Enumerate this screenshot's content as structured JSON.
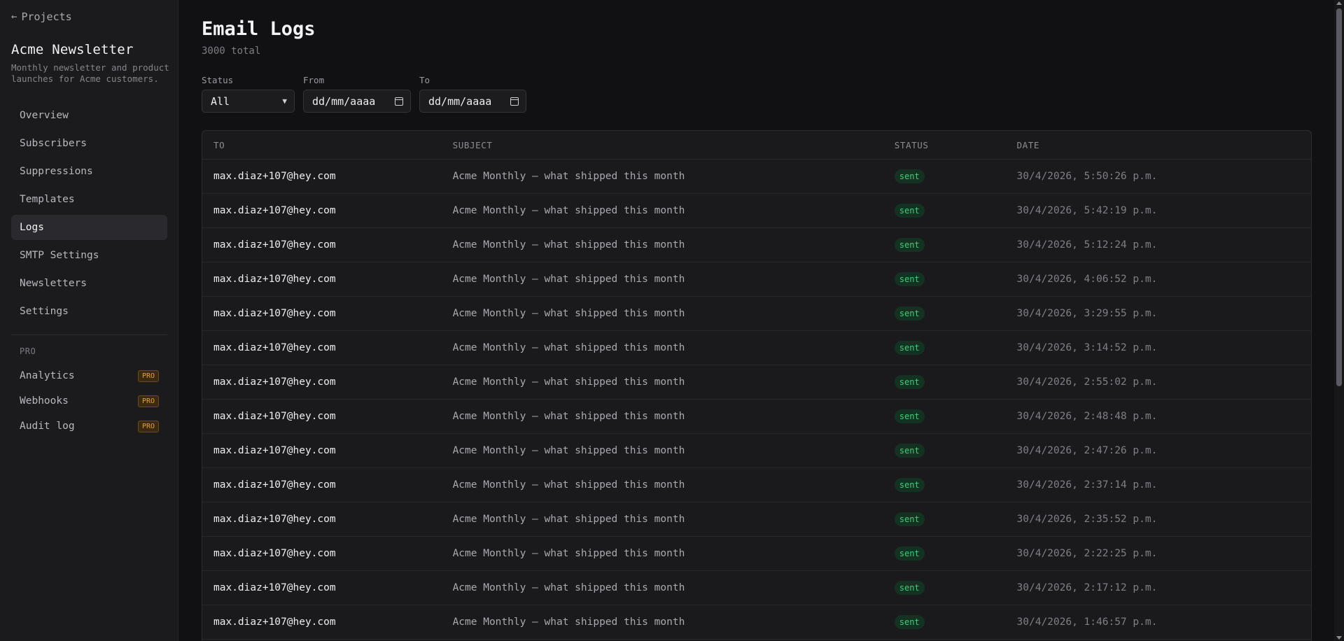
{
  "sidebar": {
    "back_label": "Projects",
    "project_name": "Acme Newsletter",
    "project_description": "Monthly newsletter and product launches for Acme customers.",
    "items": [
      {
        "label": "Overview"
      },
      {
        "label": "Subscribers"
      },
      {
        "label": "Suppressions"
      },
      {
        "label": "Templates"
      },
      {
        "label": "Logs",
        "active": true
      },
      {
        "label": "SMTP Settings"
      },
      {
        "label": "Newsletters"
      },
      {
        "label": "Settings"
      }
    ],
    "pro_heading": "PRO",
    "pro_items": [
      {
        "label": "Analytics",
        "badge": "PRO"
      },
      {
        "label": "Webhooks",
        "badge": "PRO"
      },
      {
        "label": "Audit log",
        "badge": "PRO"
      }
    ]
  },
  "header": {
    "title": "Email Logs",
    "subtitle": "3000 total"
  },
  "filters": {
    "status_label": "Status",
    "status_value": "All",
    "from_label": "From",
    "from_placeholder": "dd/mm/aaaa",
    "to_label": "To",
    "to_placeholder": "dd/mm/aaaa"
  },
  "table": {
    "columns": [
      "TO",
      "SUBJECT",
      "STATUS",
      "DATE"
    ],
    "rows": [
      {
        "to": "max.diaz+107@hey.com",
        "subject": "Acme Monthly — what shipped this month",
        "status": "sent",
        "date": "30/4/2026, 5:50:26 p.m."
      },
      {
        "to": "max.diaz+107@hey.com",
        "subject": "Acme Monthly — what shipped this month",
        "status": "sent",
        "date": "30/4/2026, 5:42:19 p.m."
      },
      {
        "to": "max.diaz+107@hey.com",
        "subject": "Acme Monthly — what shipped this month",
        "status": "sent",
        "date": "30/4/2026, 5:12:24 p.m."
      },
      {
        "to": "max.diaz+107@hey.com",
        "subject": "Acme Monthly — what shipped this month",
        "status": "sent",
        "date": "30/4/2026, 4:06:52 p.m."
      },
      {
        "to": "max.diaz+107@hey.com",
        "subject": "Acme Monthly — what shipped this month",
        "status": "sent",
        "date": "30/4/2026, 3:29:55 p.m."
      },
      {
        "to": "max.diaz+107@hey.com",
        "subject": "Acme Monthly — what shipped this month",
        "status": "sent",
        "date": "30/4/2026, 3:14:52 p.m."
      },
      {
        "to": "max.diaz+107@hey.com",
        "subject": "Acme Monthly — what shipped this month",
        "status": "sent",
        "date": "30/4/2026, 2:55:02 p.m."
      },
      {
        "to": "max.diaz+107@hey.com",
        "subject": "Acme Monthly — what shipped this month",
        "status": "sent",
        "date": "30/4/2026, 2:48:48 p.m."
      },
      {
        "to": "max.diaz+107@hey.com",
        "subject": "Acme Monthly — what shipped this month",
        "status": "sent",
        "date": "30/4/2026, 2:47:26 p.m."
      },
      {
        "to": "max.diaz+107@hey.com",
        "subject": "Acme Monthly — what shipped this month",
        "status": "sent",
        "date": "30/4/2026, 2:37:14 p.m."
      },
      {
        "to": "max.diaz+107@hey.com",
        "subject": "Acme Monthly — what shipped this month",
        "status": "sent",
        "date": "30/4/2026, 2:35:52 p.m."
      },
      {
        "to": "max.diaz+107@hey.com",
        "subject": "Acme Monthly — what shipped this month",
        "status": "sent",
        "date": "30/4/2026, 2:22:25 p.m."
      },
      {
        "to": "max.diaz+107@hey.com",
        "subject": "Acme Monthly — what shipped this month",
        "status": "sent",
        "date": "30/4/2026, 2:17:12 p.m."
      },
      {
        "to": "max.diaz+107@hey.com",
        "subject": "Acme Monthly — what shipped this month",
        "status": "sent",
        "date": "30/4/2026, 1:46:57 p.m."
      }
    ]
  }
}
